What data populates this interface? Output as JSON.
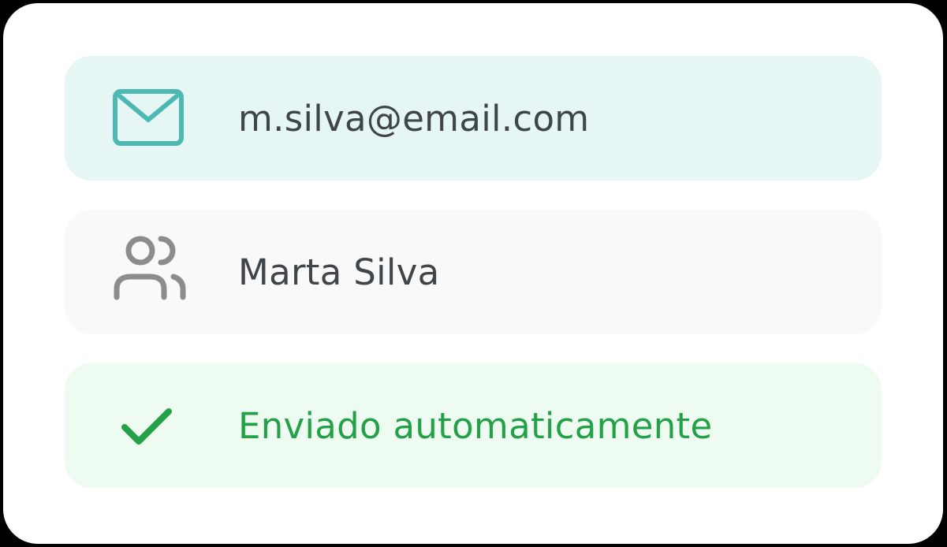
{
  "colors": {
    "email_bg": "#e6f6f4",
    "email_icon": "#4cb9b3",
    "name_bg": "#f9f9f9",
    "name_icon": "#8c8c8c",
    "status_bg": "#edfbf1",
    "status_accent": "#24a148",
    "text_dark": "#3f4549"
  },
  "rows": [
    {
      "icon": "mail-icon",
      "text": "m.silva@email.com"
    },
    {
      "icon": "users-icon",
      "text": "Marta Silva"
    },
    {
      "icon": "check-icon",
      "text": "Enviado automaticamente"
    }
  ]
}
